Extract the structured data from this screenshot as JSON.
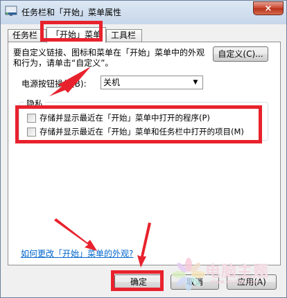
{
  "window": {
    "title": "任务栏和「开始」菜单属性",
    "close_label": "×",
    "title_icon": "taskbar-properties-icon"
  },
  "tabs": [
    {
      "label": "任务栏"
    },
    {
      "label": "「开始」菜单",
      "active": true
    },
    {
      "label": "工具栏"
    }
  ],
  "start_menu": {
    "description": "要自定义链接、图标和菜单在「开始」菜单中的外观和行为，请单击“自定义”。",
    "customize_label": "自定义(C)...",
    "power_button_label": "电源按钮操作(B):",
    "power_button_value": "关机",
    "privacy_title": "隐私",
    "privacy_options": [
      {
        "label": "存储并显示最近在「开始」菜单中打开的程序(P)",
        "checked": false
      },
      {
        "label": "存储并显示最近在「开始」菜单和任务栏中打开的项目(M)",
        "checked": false
      }
    ],
    "help_link": "如何更改「开始」菜单的外观?"
  },
  "footer": {
    "ok_label": "确定",
    "cancel_label": "取消",
    "apply_label": "应用(A)"
  },
  "annotations": {
    "highlight_color": "#e8222d"
  },
  "watermark": {
    "text": "电脑主题",
    "sub": "www.zhutiok.com"
  }
}
